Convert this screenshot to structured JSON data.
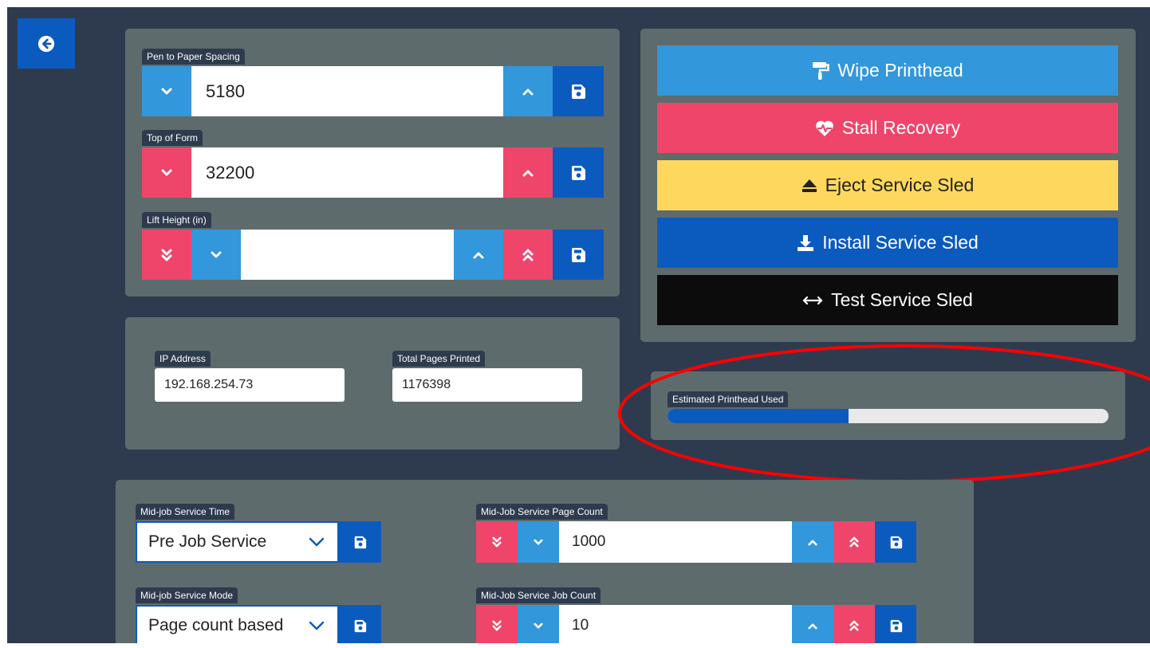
{
  "back_button": {
    "icon": "arrow-circle-left-icon"
  },
  "pen_panel": {
    "pen_to_paper": {
      "label": "Pen to Paper Spacing",
      "value": "5180"
    },
    "top_of_form": {
      "label": "Top of Form",
      "value": "32200"
    },
    "lift_height": {
      "label": "Lift Height (in)",
      "value": ""
    }
  },
  "info_panel": {
    "ip_address": {
      "label": "IP Address",
      "value": "192.168.254.73"
    },
    "total_pages": {
      "label": "Total Pages Printed",
      "value": "1176398"
    }
  },
  "actions": [
    {
      "label": "Wipe Printhead",
      "icon": "paint-roller-icon",
      "color": "#3297db",
      "text_color": "#ffffff"
    },
    {
      "label": "Stall Recovery",
      "icon": "heartbeat-icon",
      "color": "#f0456a",
      "text_color": "#ffffff"
    },
    {
      "label": "Eject Service Sled",
      "icon": "eject-icon",
      "color": "#fdd85d",
      "text_color": "#222222"
    },
    {
      "label": "Install Service Sled",
      "icon": "download-icon",
      "color": "#0b5bbf",
      "text_color": "#ffffff"
    },
    {
      "label": "Test Service Sled",
      "icon": "arrows-horizontal-icon",
      "color": "#0c0c0c",
      "text_color": "#ffffff"
    }
  ],
  "printhead": {
    "label": "Estimated Printhead Used",
    "fraction_used": 0.41
  },
  "service_panel": {
    "service_time": {
      "label": "Mid-job Service Time",
      "value": "Pre Job Service"
    },
    "service_mode": {
      "label": "Mid-job Service Mode",
      "value": "Page count based"
    },
    "page_count": {
      "label": "Mid-Job Service Page Count",
      "value": "1000"
    },
    "job_count": {
      "label": "Mid-Job Service Job Count",
      "value": "10"
    }
  },
  "colors": {
    "background": "#2e3b4e",
    "panel": "#5e6b6c",
    "light_blue": "#3297db",
    "red": "#f0456a",
    "dark_blue": "#0b5bbf",
    "yellow": "#fdd85d",
    "annotation": "#ff0000"
  }
}
